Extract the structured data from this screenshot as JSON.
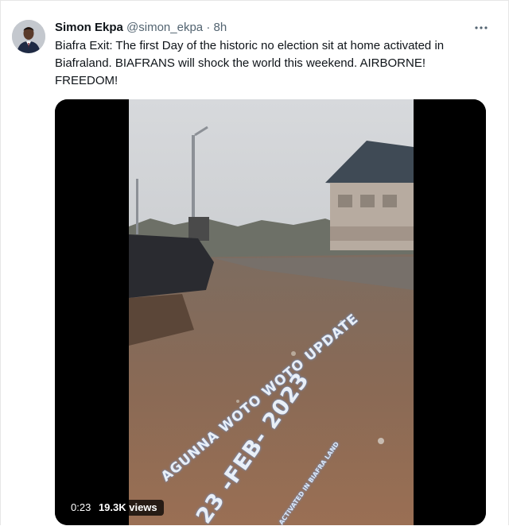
{
  "tweet": {
    "author_name": "Simon Ekpa",
    "handle": "@simon_ekpa",
    "separator": "·",
    "time": "8h",
    "more_icon": "more-horizontal-icon",
    "text": "Biafra Exit: The first Day of the historic no election sit at home activated in\nBiafraland. BIAFRANS will shock the world this weekend. AIRBORNE!\nFREEDOM!"
  },
  "video": {
    "overlay_line1": "AGUNNA WOTO WOTO UPDATE",
    "overlay_date": "23 -FEB- 2023",
    "overlay_line3": "ACTIVATED IN BIAFRA LAND",
    "duration": "0:23",
    "views": "19.3K views"
  }
}
